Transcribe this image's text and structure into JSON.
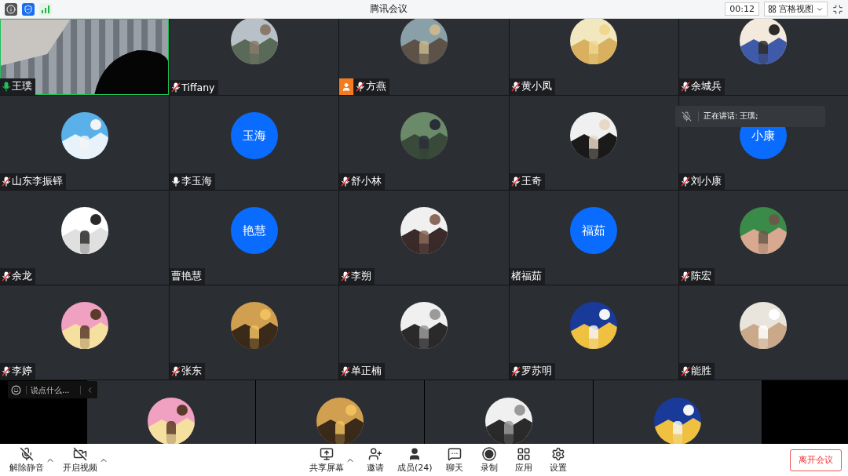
{
  "top_bar": {
    "title": "腾讯会议",
    "timer": "00:12",
    "view_mode": "宫格视图"
  },
  "tiles": [
    {
      "name": "王璞",
      "kind": "video",
      "mic_icon": true,
      "muted": false,
      "speaking": true,
      "host_badge": false
    },
    {
      "name": "Tiffany",
      "kind": "picture",
      "mic_icon": true,
      "muted": true,
      "speaking": false,
      "host_badge": false
    },
    {
      "name": "方燕",
      "kind": "picture",
      "mic_icon": true,
      "muted": true,
      "speaking": false,
      "host_badge": true
    },
    {
      "name": "黄小凤",
      "kind": "picture",
      "mic_icon": true,
      "muted": true,
      "speaking": false,
      "host_badge": false
    },
    {
      "name": "余城兵",
      "kind": "picture",
      "mic_icon": true,
      "muted": true,
      "speaking": false,
      "host_badge": false
    },
    {
      "name": "山东李振铎",
      "kind": "picture",
      "mic_icon": true,
      "muted": true,
      "speaking": false,
      "host_badge": false
    },
    {
      "name": "李玉海",
      "kind": "initials",
      "initials": "玉海",
      "mic_icon": true,
      "muted": false,
      "speaking": false,
      "host_badge": false
    },
    {
      "name": "舒小林",
      "kind": "picture",
      "mic_icon": true,
      "muted": true,
      "speaking": false,
      "host_badge": false
    },
    {
      "name": "王奇",
      "kind": "picture",
      "mic_icon": true,
      "muted": true,
      "speaking": false,
      "host_badge": false
    },
    {
      "name": "刘小康",
      "kind": "initials",
      "initials": "小康",
      "mic_icon": true,
      "muted": true,
      "speaking": false,
      "host_badge": false
    },
    {
      "name": "余龙",
      "kind": "picture",
      "mic_icon": true,
      "muted": true,
      "speaking": false,
      "host_badge": false
    },
    {
      "name": "曹艳慧",
      "kind": "initials",
      "initials": "艳慧",
      "mic_icon": false,
      "speaking": false,
      "host_badge": false
    },
    {
      "name": "李朔",
      "kind": "picture",
      "mic_icon": true,
      "muted": true,
      "speaking": false,
      "host_badge": false
    },
    {
      "name": "楮福茹",
      "kind": "initials",
      "initials": "福茹",
      "mic_icon": false,
      "speaking": false,
      "host_badge": false
    },
    {
      "name": "陈宏",
      "kind": "picture",
      "mic_icon": true,
      "muted": true,
      "speaking": false,
      "host_badge": false
    },
    {
      "name": "李婷",
      "kind": "picture",
      "mic_icon": true,
      "muted": true,
      "speaking": false,
      "host_badge": false
    },
    {
      "name": "张东",
      "kind": "picture",
      "mic_icon": true,
      "muted": true,
      "speaking": false,
      "host_badge": false
    },
    {
      "name": "单正楠",
      "kind": "picture",
      "mic_icon": true,
      "muted": true,
      "speaking": false,
      "host_badge": false
    },
    {
      "name": "罗苏明",
      "kind": "picture",
      "mic_icon": true,
      "muted": true,
      "speaking": false,
      "host_badge": false
    },
    {
      "name": "能胜",
      "kind": "picture",
      "mic_icon": true,
      "muted": true,
      "speaking": false,
      "host_badge": false
    }
  ],
  "chat_box": {
    "placeholder": "说点什么..."
  },
  "speaking_notice": {
    "text": "正在讲话: 王璞;"
  },
  "toolbar": {
    "left": [
      {
        "label": "解除静音",
        "caret": true
      },
      {
        "label": "开启视频",
        "caret": true
      }
    ],
    "center": [
      {
        "label": "共享屏幕",
        "caret": true
      },
      {
        "label": "邀请",
        "caret": false
      },
      {
        "label": "成员(24)",
        "caret": false
      },
      {
        "label": "聊天",
        "caret": false
      },
      {
        "label": "录制",
        "caret": false
      },
      {
        "label": "应用",
        "caret": false
      },
      {
        "label": "设置",
        "caret": false
      }
    ],
    "leave_button": "离开会议"
  }
}
